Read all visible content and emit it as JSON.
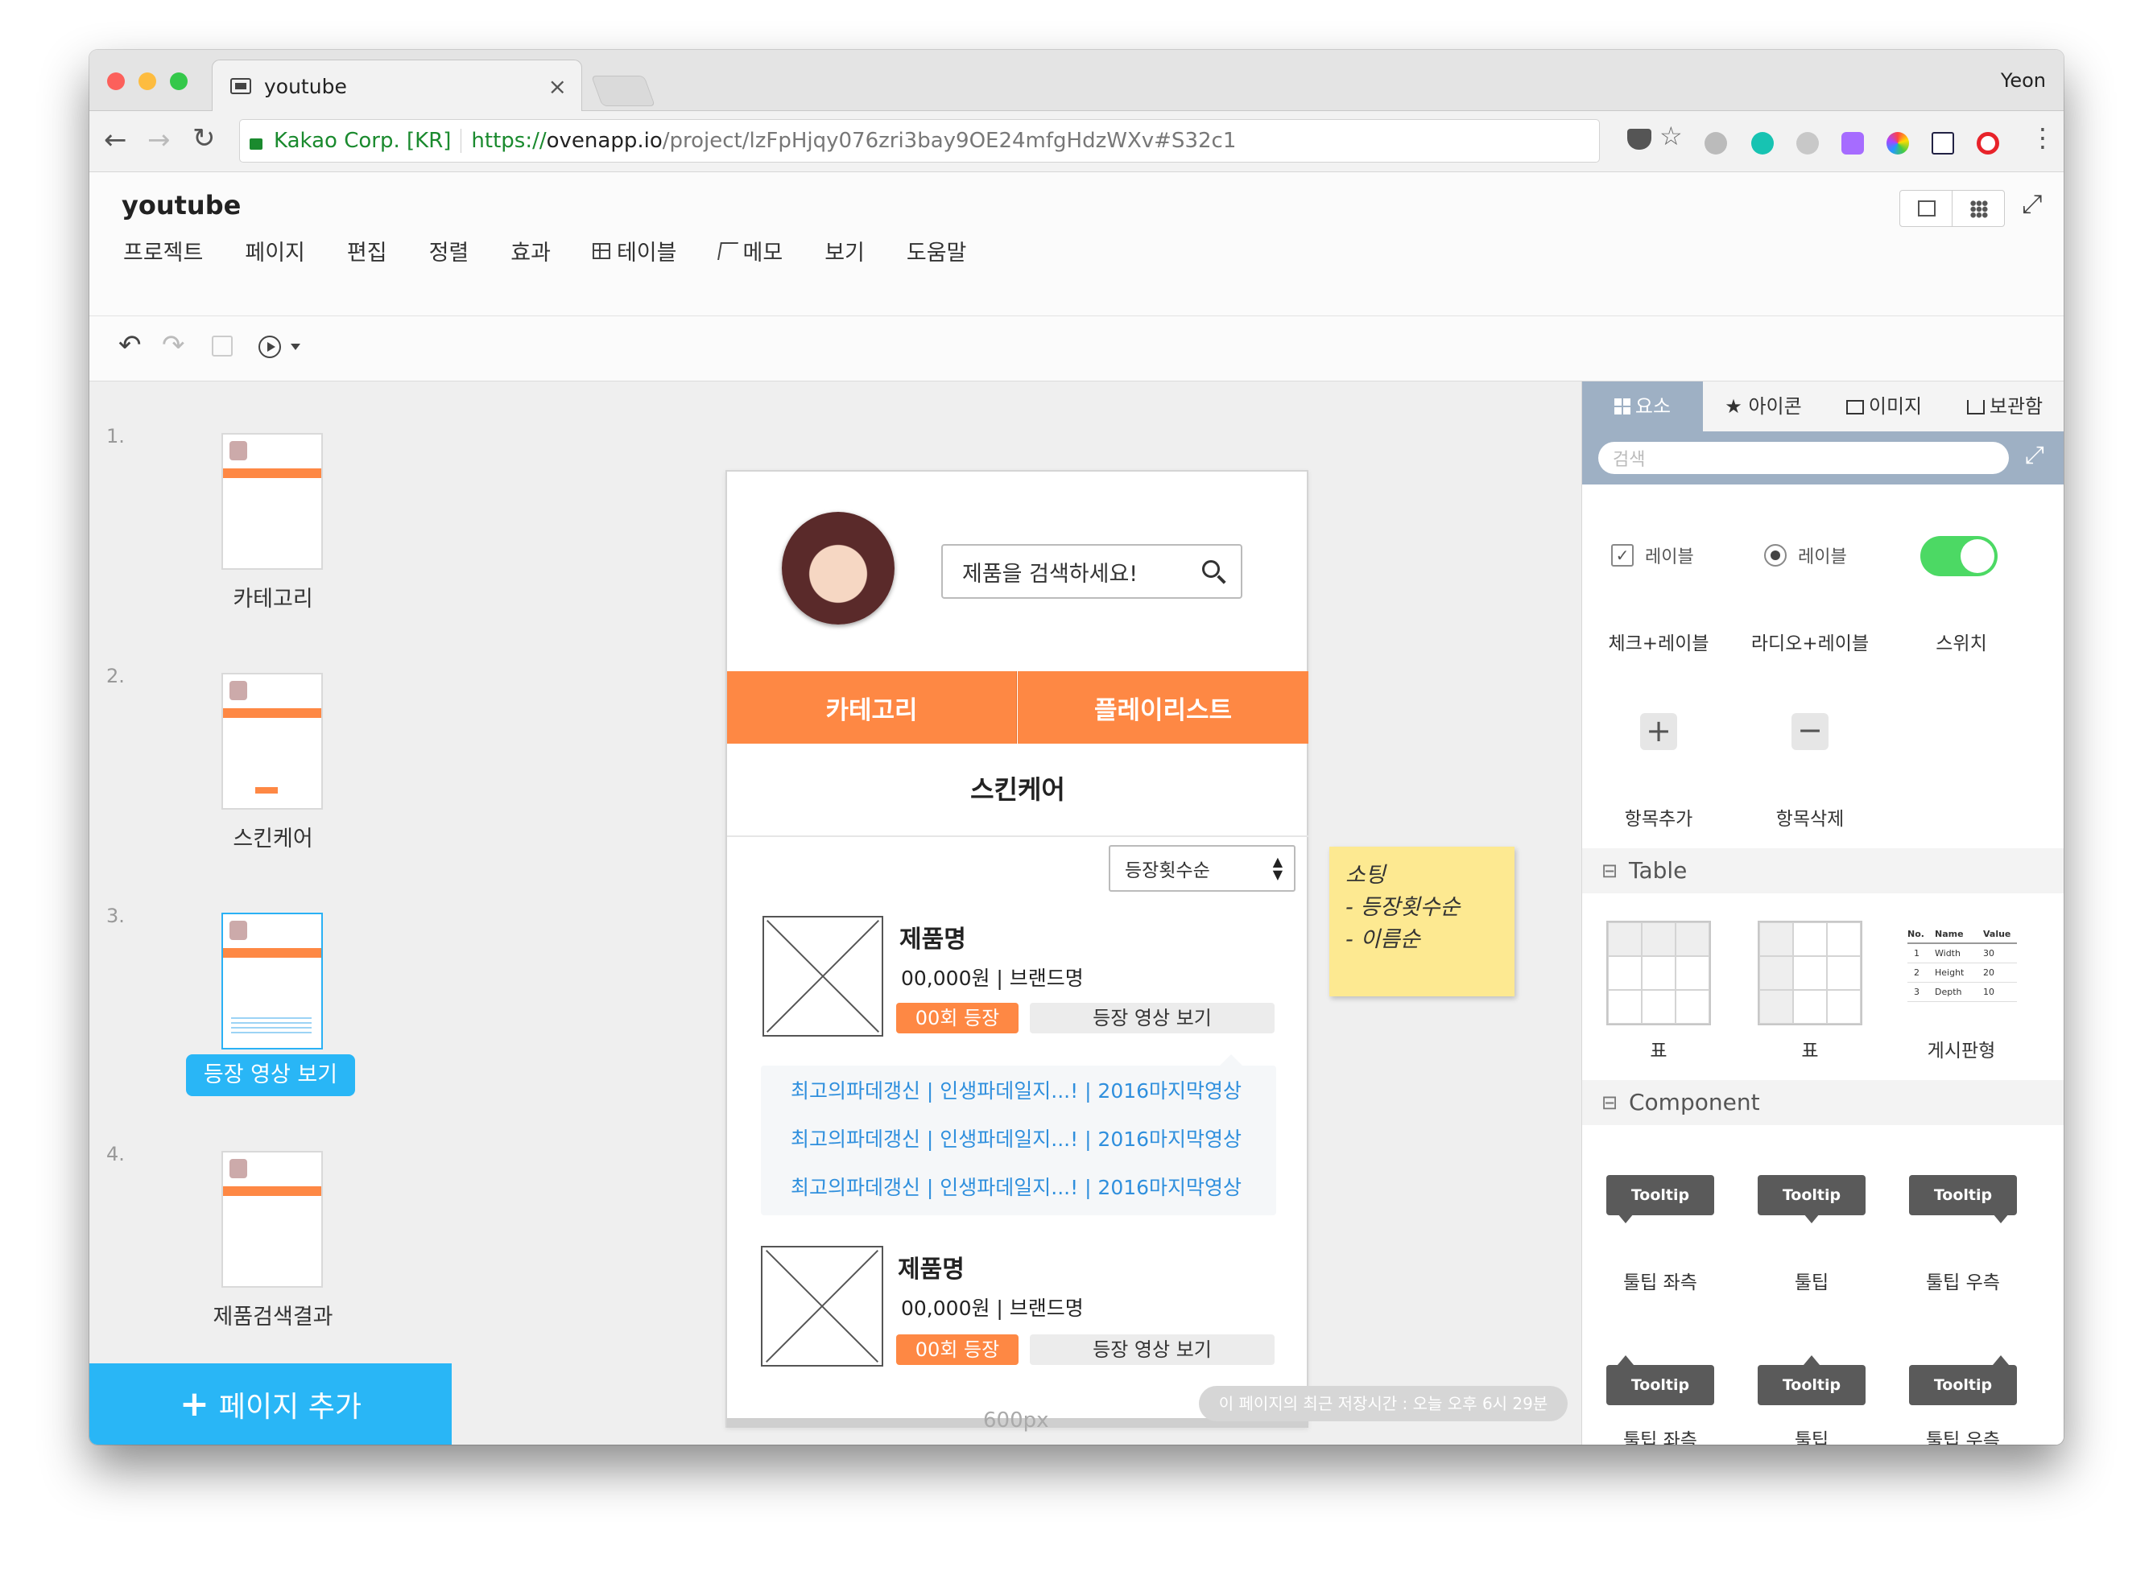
{
  "browser": {
    "tab_title": "youtube",
    "tab_close": "×",
    "profile": "Yeon",
    "security": "Kakao Corp. [KR]",
    "url_scheme": "https://",
    "url_host": "ovenapp.io",
    "url_path": "/project/lzFpHjqy076zri3bay9OE24mfgHdzWXv#S32c1"
  },
  "app": {
    "title": "youtube",
    "menu": [
      "프로젝트",
      "페이지",
      "편집",
      "정렬",
      "효과",
      "테이블",
      "메모",
      "보기",
      "도움말"
    ]
  },
  "pages": [
    {
      "num": "1.",
      "label": "카테고리"
    },
    {
      "num": "2.",
      "label": "스킨케어"
    },
    {
      "num": "3.",
      "label": "등장 영상 보기"
    },
    {
      "num": "4.",
      "label": "제품검색결과"
    },
    {
      "num": "5.",
      "label": ""
    }
  ],
  "add_page_label": "페이지 추가",
  "phone": {
    "search_placeholder": "제품을 검색하세요!",
    "tab_category": "카테고리",
    "tab_playlist": "플레이리스트",
    "section_title": "스킨케어",
    "sort_value": "등장횟수순",
    "items": [
      {
        "name": "제품명",
        "price": "00,000원 | 브랜드명",
        "count": "00회 등장",
        "button": "등장 영상 보기"
      },
      {
        "name": "제품명",
        "price": "00,000원 | 브랜드명",
        "count": "00회 등장",
        "button": "등장 영상 보기"
      }
    ],
    "video_links": [
      "최고의파데갱신 | 인생파데일지...! | 2016마지막영상",
      "최고의파데갱신 | 인생파데일지...! | 2016마지막영상",
      "최고의파데갱신 | 인생파데일지...! | 2016마지막영상"
    ]
  },
  "memo": {
    "line1": "소팅",
    "line2": "- 등장횟수순",
    "line3": "- 이름순"
  },
  "canvas_width_label": "600px",
  "save_status": "이 페이지의 최근 저장시간 : 오늘 오후 6시 29분",
  "panel": {
    "tabs": [
      "요소",
      "아이콘",
      "이미지",
      "보관함"
    ],
    "search_placeholder": "검색",
    "elements": {
      "checkbox_label": "레이블",
      "radio_label": "레이블",
      "checkbox_caption": "체크+레이블",
      "radio_caption": "라디오+레이블",
      "switch_caption": "스위치",
      "add_caption": "항목추가",
      "remove_caption": "항목삭제"
    },
    "table_section": "Table",
    "table_items": [
      "표",
      "표",
      "게시판형"
    ],
    "board_headers": [
      "No.",
      "Name",
      "Value"
    ],
    "board_rows": [
      [
        "1",
        "Width",
        "30"
      ],
      [
        "2",
        "Height",
        "20"
      ],
      [
        "3",
        "Depth",
        "10"
      ]
    ],
    "component_section": "Component",
    "tooltip_text": "Tooltip",
    "tooltip_captions": [
      "툴팁 좌측",
      "툴팁",
      "툴팁 우측",
      "툴팁 좌측",
      "툴팁",
      "툴팁 우측"
    ]
  },
  "colors": {
    "accent_orange": "#fe8844",
    "accent_blue": "#29b6f6",
    "link_blue": "#2f8fdd",
    "switch_green": "#4cd964",
    "memo_yellow": "#fde991"
  }
}
